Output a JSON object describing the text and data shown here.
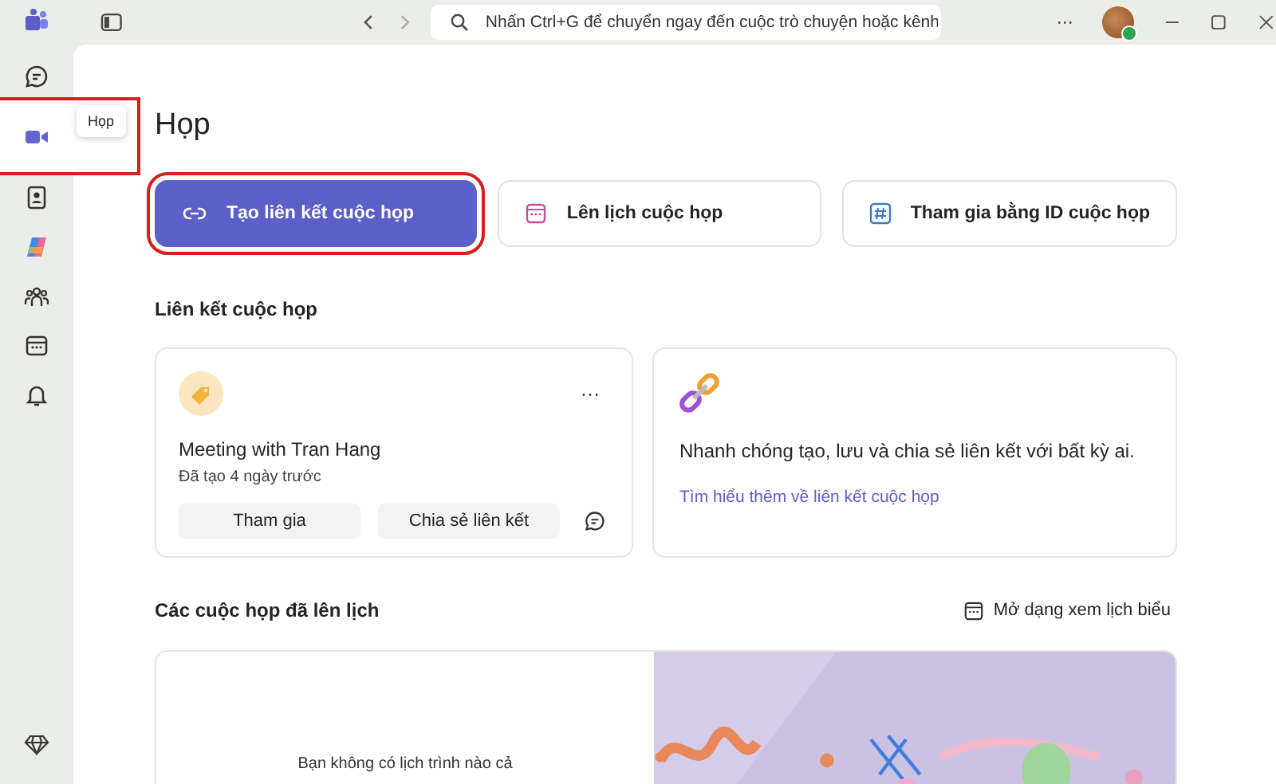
{
  "rail": {
    "items": [
      {
        "kind": "chat",
        "selected": false,
        "highlighted": false
      },
      {
        "kind": "video",
        "selected": true,
        "highlighted": true
      },
      {
        "kind": "contact",
        "selected": false,
        "highlighted": false
      },
      {
        "kind": "copilot",
        "selected": false,
        "highlighted": false
      },
      {
        "kind": "people",
        "selected": false,
        "highlighted": false
      },
      {
        "kind": "calendar",
        "selected": false,
        "highlighted": false
      },
      {
        "kind": "bell",
        "selected": false,
        "highlighted": false
      }
    ],
    "tooltip": "Họp"
  },
  "search": {
    "placeholder": "Nhấn Ctrl+G để chuyển ngay đến cuộc trò chuyện hoặc kênh"
  },
  "more": "···",
  "page_title": "Họp",
  "actions": [
    {
      "kind": "link",
      "label": "Tạo liên kết cuộc họp",
      "primary": true,
      "highlighted": true
    },
    {
      "kind": "calendar",
      "label": "Lên lịch cuộc họp",
      "primary": false,
      "highlighted": false
    },
    {
      "kind": "hash",
      "label": "Tham gia bằng ID cuộc họp",
      "primary": false,
      "highlighted": false
    }
  ],
  "links_section": {
    "title": "Liên kết cuộc họp",
    "meeting": {
      "title": "Meeting with Tran Hang",
      "subtitle": "Đã tạo 4 ngày trước",
      "more": "···",
      "buttons": [
        "Tham gia",
        "Chia sẻ liên kết"
      ]
    },
    "promo": {
      "text": "Nhanh chóng tạo, lưu và chia sẻ liên kết với bất kỳ ai.",
      "link": "Tìm hiểu thêm về liên kết cuộc họp"
    }
  },
  "scheduled": {
    "title": "Các cuộc họp đã lên lịch",
    "calendar_view": "Mở dạng xem lịch biểu",
    "empty": "Bạn không có lịch trình nào cả"
  }
}
